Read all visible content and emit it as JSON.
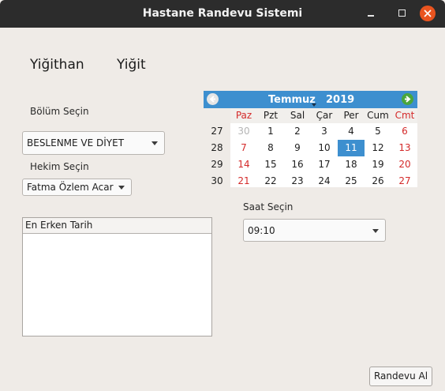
{
  "window": {
    "title": "Hastane Randevu Sistemi"
  },
  "patient": {
    "first_name": "Yiğithan",
    "last_name": "Yiğit"
  },
  "department": {
    "label": "Bölüm Seçin",
    "selected": "BESLENME VE DİYET"
  },
  "doctor": {
    "label": "Hekim Seçin",
    "selected": "Fatma Özlem Acar"
  },
  "earliest": {
    "header": "En Erken Tarih",
    "items": []
  },
  "time": {
    "label": "Saat Seçin",
    "selected": "09:10"
  },
  "calendar": {
    "month": "Temmuz",
    "year": "2019",
    "weekdays": [
      "Paz",
      "Pzt",
      "Sal",
      "Çar",
      "Per",
      "Cum",
      "Cmt"
    ],
    "week_numbers": [
      "27",
      "28",
      "29",
      "30"
    ],
    "weeks": [
      [
        "30",
        "1",
        "2",
        "3",
        "4",
        "5",
        "6"
      ],
      [
        "7",
        "8",
        "9",
        "10",
        "11",
        "12",
        "13"
      ],
      [
        "14",
        "15",
        "16",
        "17",
        "18",
        "19",
        "20"
      ],
      [
        "21",
        "22",
        "23",
        "24",
        "25",
        "26",
        "27"
      ]
    ],
    "selected_day": "11",
    "weekend_color": "#d42a2a",
    "selection_color": "#3d8fcf"
  },
  "actions": {
    "submit_label": "Randevu Al"
  },
  "icons": {
    "prev": "arrow-left-icon",
    "next": "arrow-right-icon",
    "close": "close-icon"
  }
}
